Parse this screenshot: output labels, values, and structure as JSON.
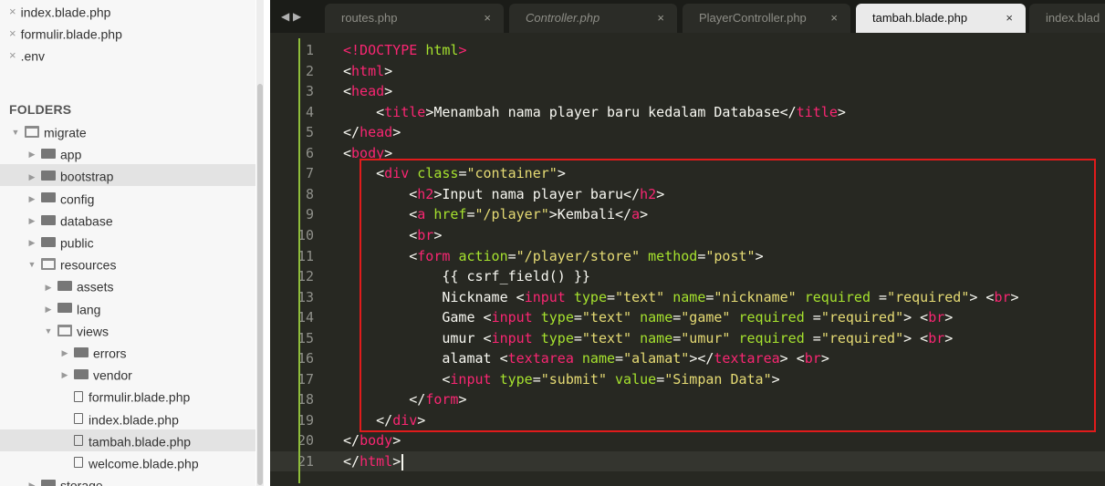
{
  "sidebar": {
    "open_files": [
      "index.blade.php",
      "formulir.blade.php",
      ".env"
    ],
    "close_glyph": "×",
    "folders_title": "FOLDERS",
    "tree": [
      {
        "label": "migrate",
        "kind": "folder",
        "expanded": true,
        "depth": 0
      },
      {
        "label": "app",
        "kind": "folder",
        "expanded": false,
        "depth": 1
      },
      {
        "label": "bootstrap",
        "kind": "folder",
        "expanded": false,
        "depth": 1,
        "selected": true
      },
      {
        "label": "config",
        "kind": "folder",
        "expanded": false,
        "depth": 1
      },
      {
        "label": "database",
        "kind": "folder",
        "expanded": false,
        "depth": 1
      },
      {
        "label": "public",
        "kind": "folder",
        "expanded": false,
        "depth": 1
      },
      {
        "label": "resources",
        "kind": "folder",
        "expanded": true,
        "depth": 1
      },
      {
        "label": "assets",
        "kind": "folder",
        "expanded": false,
        "depth": 2
      },
      {
        "label": "lang",
        "kind": "folder",
        "expanded": false,
        "depth": 2
      },
      {
        "label": "views",
        "kind": "folder",
        "expanded": true,
        "depth": 2
      },
      {
        "label": "errors",
        "kind": "folder",
        "expanded": false,
        "depth": 3
      },
      {
        "label": "vendor",
        "kind": "folder",
        "expanded": false,
        "depth": 3
      },
      {
        "label": "formulir.blade.php",
        "kind": "file",
        "depth": 3
      },
      {
        "label": "index.blade.php",
        "kind": "file",
        "depth": 3
      },
      {
        "label": "tambah.blade.php",
        "kind": "file",
        "depth": 3,
        "selected": true
      },
      {
        "label": "welcome.blade.php",
        "kind": "file",
        "depth": 3
      },
      {
        "label": "storage",
        "kind": "folder",
        "expanded": false,
        "depth": 1
      }
    ]
  },
  "editor": {
    "nav_arrows": "◀ ▶",
    "tabs": [
      {
        "label": "routes.php",
        "close": "×",
        "active": false,
        "italic": false
      },
      {
        "label": "Controller.php",
        "close": "×",
        "active": false,
        "italic": true
      },
      {
        "label": "PlayerController.php",
        "close": "×",
        "active": false,
        "italic": false
      },
      {
        "label": "tambah.blade.php",
        "close": "×",
        "active": true,
        "italic": false
      },
      {
        "label": "index.blad",
        "close": "",
        "active": false,
        "italic": false
      }
    ],
    "current_line": 21,
    "lines": [
      {
        "n": "1",
        "tokens": [
          [
            "tg",
            "<!DOCTYPE "
          ],
          [
            "at",
            "html"
          ],
          [
            "tg",
            ">"
          ]
        ]
      },
      {
        "n": "2",
        "tokens": [
          [
            "tx",
            "<"
          ],
          [
            "tg",
            "html"
          ],
          [
            "tx",
            ">"
          ]
        ]
      },
      {
        "n": "3",
        "tokens": [
          [
            "tx",
            "<"
          ],
          [
            "tg",
            "head"
          ],
          [
            "tx",
            ">"
          ]
        ]
      },
      {
        "n": "4",
        "tokens": [
          [
            "tx",
            "    <"
          ],
          [
            "tg",
            "title"
          ],
          [
            "tx",
            ">Menambah nama player baru kedalam Database</"
          ],
          [
            "tg",
            "title"
          ],
          [
            "tx",
            ">"
          ]
        ]
      },
      {
        "n": "5",
        "tokens": [
          [
            "tx",
            "</"
          ],
          [
            "tg",
            "head"
          ],
          [
            "tx",
            ">"
          ]
        ]
      },
      {
        "n": "6",
        "tokens": [
          [
            "tx",
            "<"
          ],
          [
            "tg",
            "body"
          ],
          [
            "tx",
            ">"
          ]
        ]
      },
      {
        "n": "7",
        "tokens": [
          [
            "tx",
            "    <"
          ],
          [
            "tg",
            "div"
          ],
          [
            "tx",
            " "
          ],
          [
            "at",
            "class"
          ],
          [
            "tx",
            "="
          ],
          [
            "st",
            "\"container\""
          ],
          [
            "tx",
            ">"
          ]
        ]
      },
      {
        "n": "8",
        "tokens": [
          [
            "tx",
            "        <"
          ],
          [
            "tg",
            "h2"
          ],
          [
            "tx",
            ">Input nama player baru</"
          ],
          [
            "tg",
            "h2"
          ],
          [
            "tx",
            ">"
          ]
        ]
      },
      {
        "n": "9",
        "tokens": [
          [
            "tx",
            "        <"
          ],
          [
            "tg",
            "a"
          ],
          [
            "tx",
            " "
          ],
          [
            "at",
            "href"
          ],
          [
            "tx",
            "="
          ],
          [
            "st",
            "\"/player\""
          ],
          [
            "tx",
            ">Kembali</"
          ],
          [
            "tg",
            "a"
          ],
          [
            "tx",
            ">"
          ]
        ]
      },
      {
        "n": "10",
        "tokens": [
          [
            "tx",
            "        <"
          ],
          [
            "tg",
            "br"
          ],
          [
            "tx",
            ">"
          ]
        ]
      },
      {
        "n": "11",
        "tokens": [
          [
            "tx",
            "        <"
          ],
          [
            "tg",
            "form"
          ],
          [
            "tx",
            " "
          ],
          [
            "at",
            "action"
          ],
          [
            "tx",
            "="
          ],
          [
            "st",
            "\"/player/store\""
          ],
          [
            "tx",
            " "
          ],
          [
            "at",
            "method"
          ],
          [
            "tx",
            "="
          ],
          [
            "st",
            "\"post\""
          ],
          [
            "tx",
            ">"
          ]
        ]
      },
      {
        "n": "12",
        "tokens": [
          [
            "tx",
            "            {{ csrf_field() }}"
          ]
        ]
      },
      {
        "n": "13",
        "tokens": [
          [
            "tx",
            "            Nickname <"
          ],
          [
            "tg",
            "input"
          ],
          [
            "tx",
            " "
          ],
          [
            "at",
            "type"
          ],
          [
            "tx",
            "="
          ],
          [
            "st",
            "\"text\""
          ],
          [
            "tx",
            " "
          ],
          [
            "at",
            "name"
          ],
          [
            "tx",
            "="
          ],
          [
            "st",
            "\"nickname\""
          ],
          [
            "tx",
            " "
          ],
          [
            "at",
            "required"
          ],
          [
            "tx",
            " ="
          ],
          [
            "st",
            "\"required\""
          ],
          [
            "tx",
            "> <"
          ],
          [
            "tg",
            "br"
          ],
          [
            "tx",
            ">"
          ]
        ]
      },
      {
        "n": "14",
        "tokens": [
          [
            "tx",
            "            Game <"
          ],
          [
            "tg",
            "input"
          ],
          [
            "tx",
            " "
          ],
          [
            "at",
            "type"
          ],
          [
            "tx",
            "="
          ],
          [
            "st",
            "\"text\""
          ],
          [
            "tx",
            " "
          ],
          [
            "at",
            "name"
          ],
          [
            "tx",
            "="
          ],
          [
            "st",
            "\"game\""
          ],
          [
            "tx",
            " "
          ],
          [
            "at",
            "required"
          ],
          [
            "tx",
            " ="
          ],
          [
            "st",
            "\"required\""
          ],
          [
            "tx",
            "> <"
          ],
          [
            "tg",
            "br"
          ],
          [
            "tx",
            ">"
          ]
        ]
      },
      {
        "n": "15",
        "tokens": [
          [
            "tx",
            "            umur <"
          ],
          [
            "tg",
            "input"
          ],
          [
            "tx",
            " "
          ],
          [
            "at",
            "type"
          ],
          [
            "tx",
            "="
          ],
          [
            "st",
            "\"text\""
          ],
          [
            "tx",
            " "
          ],
          [
            "at",
            "name"
          ],
          [
            "tx",
            "="
          ],
          [
            "st",
            "\"umur\""
          ],
          [
            "tx",
            " "
          ],
          [
            "at",
            "required"
          ],
          [
            "tx",
            " ="
          ],
          [
            "st",
            "\"required\""
          ],
          [
            "tx",
            "> <"
          ],
          [
            "tg",
            "br"
          ],
          [
            "tx",
            ">"
          ]
        ]
      },
      {
        "n": "16",
        "tokens": [
          [
            "tx",
            "            alamat <"
          ],
          [
            "tg",
            "textarea"
          ],
          [
            "tx",
            " "
          ],
          [
            "at",
            "name"
          ],
          [
            "tx",
            "="
          ],
          [
            "st",
            "\"alamat\""
          ],
          [
            "tx",
            "></"
          ],
          [
            "tg",
            "textarea"
          ],
          [
            "tx",
            "> <"
          ],
          [
            "tg",
            "br"
          ],
          [
            "tx",
            ">"
          ]
        ]
      },
      {
        "n": "17",
        "tokens": [
          [
            "tx",
            "            <"
          ],
          [
            "tg",
            "input"
          ],
          [
            "tx",
            " "
          ],
          [
            "at",
            "type"
          ],
          [
            "tx",
            "="
          ],
          [
            "st",
            "\"submit\""
          ],
          [
            "tx",
            " "
          ],
          [
            "at",
            "value"
          ],
          [
            "tx",
            "="
          ],
          [
            "st",
            "\"Simpan Data\""
          ],
          [
            "tx",
            ">"
          ]
        ]
      },
      {
        "n": "18",
        "tokens": [
          [
            "tx",
            "        </"
          ],
          [
            "tg",
            "form"
          ],
          [
            "tx",
            ">"
          ]
        ]
      },
      {
        "n": "19",
        "tokens": [
          [
            "tx",
            "    </"
          ],
          [
            "tg",
            "div"
          ],
          [
            "tx",
            ">"
          ]
        ]
      },
      {
        "n": "20",
        "tokens": [
          [
            "tx",
            "</"
          ],
          [
            "tg",
            "body"
          ],
          [
            "tx",
            ">"
          ]
        ]
      },
      {
        "n": "21",
        "tokens": [
          [
            "tx",
            "</"
          ],
          [
            "tg",
            "html"
          ],
          [
            "tx",
            ">"
          ]
        ]
      }
    ]
  },
  "colors": {
    "editor_bg": "#272822",
    "tag": "#f92672",
    "attribute": "#a6e22e",
    "string": "#e6db74",
    "text": "#f8f8f2",
    "highlight_box": "#e01b1b",
    "gutter_mark": "#8fbe3a"
  }
}
